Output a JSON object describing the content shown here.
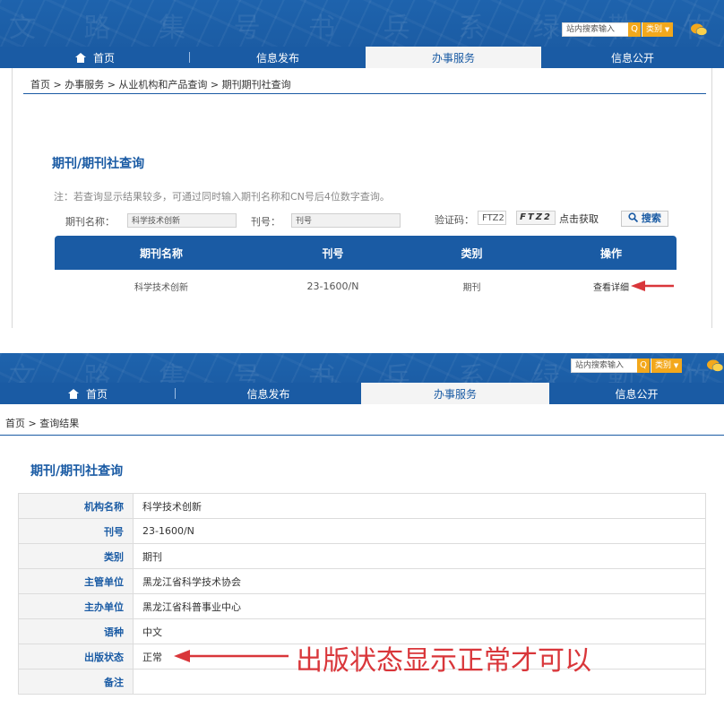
{
  "header": {
    "search_placeholder": "站内搜索输入",
    "category_label": "类别",
    "dropdown_glyph": "▼",
    "search_glyph": "Q",
    "calligraphy": "文 路 集 号 书 兵 系 绿 勒 竹 言 义 伦 道"
  },
  "nav": {
    "items": [
      {
        "label": "首页"
      },
      {
        "label": "信息发布"
      },
      {
        "label": "办事服务"
      },
      {
        "label": "信息公开"
      }
    ]
  },
  "search_page": {
    "breadcrumb": "首页 > 办事服务 > 从业机构和产品查询 > 期刊期刊社查询",
    "title": "期刊/期刊社查询",
    "note": "注：若查询显示结果较多，可通过同时输入期刊名称和CN号后4位数字查询。",
    "name_label": "期刊名称：",
    "name_value": "科学技术创新",
    "number_label": "刊号：",
    "number_placeholder": "刊号",
    "captcha_label": "验证码：",
    "captcha_input": "FTZ2",
    "captcha_image": "FTZ2",
    "captcha_refresh": "点击获取",
    "search_button": "搜索",
    "table": {
      "headers": [
        "期刊名称",
        "刊号",
        "类别",
        "操作"
      ],
      "rows": [
        {
          "name": "科学技术创新",
          "number": "23-1600/N",
          "category": "期刊",
          "action": "查看详细"
        }
      ]
    }
  },
  "result_page": {
    "breadcrumb": "首页 > 查询结果",
    "title": "期刊/期刊社查询",
    "rows": [
      {
        "key": "机构名称",
        "value": "科学技术创新"
      },
      {
        "key": "刊号",
        "value": "23-1600/N"
      },
      {
        "key": "类别",
        "value": "期刊"
      },
      {
        "key": "主管单位",
        "value": "黑龙江省科学技术协会"
      },
      {
        "key": "主办单位",
        "value": "黑龙江省科普事业中心"
      },
      {
        "key": "语种",
        "value": "中文"
      },
      {
        "key": "出版状态",
        "value": "正常"
      },
      {
        "key": "备注",
        "value": ""
      }
    ]
  },
  "annotation": {
    "text": "出版状态显示正常才可以",
    "color": "#d9363a"
  },
  "colors": {
    "brand": "#1a5ba4",
    "accent": "#f3a81c"
  }
}
